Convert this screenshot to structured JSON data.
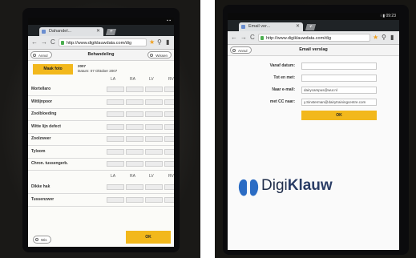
{
  "left": {
    "status_right": "▪ ▪",
    "tab_title": "Dahandel...",
    "tab_close": "✕",
    "new_tab": "+",
    "url": "http://www.digiklauwdata.com/dig",
    "nav_back": "←",
    "nav_forward": "→",
    "nav_reload": "C",
    "star_glyph": "★",
    "search_glyph": "⚲",
    "bookmark_glyph": "▮",
    "appbar_title": "Behandeling",
    "appbar_left": "Annul",
    "appbar_right": "Wissen",
    "photo_button": "Maak foto",
    "cow_number": "2007",
    "cow_details_line1": "Datum: 07 Oktober 2007",
    "col_headers_top": [
      "LA",
      "RA",
      "LV",
      "RV"
    ],
    "col_headers_bottom": [
      "LA",
      "RA",
      "LV",
      "RV"
    ],
    "rows_top": [
      "Mortellaro",
      "Witlijnpoor",
      "Zoolbloeding",
      "Witte lijn defect",
      "Zoolzweer",
      "Tyloom",
      "Chron. tussengerb."
    ],
    "rows_bottom": [
      "Dikke hak",
      "Tussenzwvr"
    ],
    "footer_left": "Wis",
    "footer_right": "OK"
  },
  "right": {
    "status_right": "⁝ ▮ 09:23",
    "tab_title": "Email ver...",
    "tab_close": "✕",
    "new_tab": "+",
    "url": "http://www.digiklauwdata.com/dig",
    "nav_back": "←",
    "nav_forward": "→",
    "nav_reload": "C",
    "star_glyph": "★",
    "search_glyph": "⚲",
    "bookmark_glyph": "▮",
    "appbar_title": "Email verslag",
    "appbar_left": "Annul",
    "fields": [
      {
        "label": "Vanaf datum:",
        "value": ""
      },
      {
        "label": "Tot en met:",
        "value": ""
      },
      {
        "label": "Naar e-mail:",
        "value": "dairycampus@wur.nl"
      },
      {
        "label": "met CC naar:",
        "value": "y.Sinsterman@dairytrainingcentre.com"
      }
    ],
    "ok_button": "OK",
    "brand_digi": "Digi",
    "brand_klauw": "Klauw"
  },
  "colors": {
    "accent_yellow": "#f2b81c",
    "logo_blue": "#2b6cc4"
  }
}
